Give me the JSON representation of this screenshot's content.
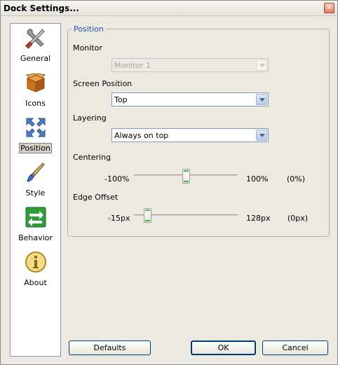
{
  "window": {
    "title": "Dock Settings...",
    "close_glyph": "✕"
  },
  "sidebar": {
    "items": [
      {
        "label": "General",
        "icon": "tools-icon"
      },
      {
        "label": "Icons",
        "icon": "box-icon"
      },
      {
        "label": "Position",
        "icon": "position-arrows-icon",
        "active": true
      },
      {
        "label": "Style",
        "icon": "brush-icon"
      },
      {
        "label": "Behavior",
        "icon": "behavior-arrows-icon"
      },
      {
        "label": "About",
        "icon": "info-icon"
      }
    ]
  },
  "position": {
    "legend": "Position",
    "monitor": {
      "label": "Monitor",
      "value": "Monitor 1",
      "disabled": true
    },
    "screen_position": {
      "label": "Screen Position",
      "value": "Top"
    },
    "layering": {
      "label": "Layering",
      "value": "Always on top"
    },
    "centering": {
      "label": "Centering",
      "min": "-100%",
      "max": "100%",
      "current": "(0%)",
      "level": 0.5
    },
    "edge_offset": {
      "label": "Edge Offset",
      "min": "-15px",
      "max": "128px",
      "current": "(0px)",
      "level": 0.105
    }
  },
  "buttons": {
    "defaults": "Defaults",
    "ok": "OK",
    "cancel": "Cancel"
  }
}
